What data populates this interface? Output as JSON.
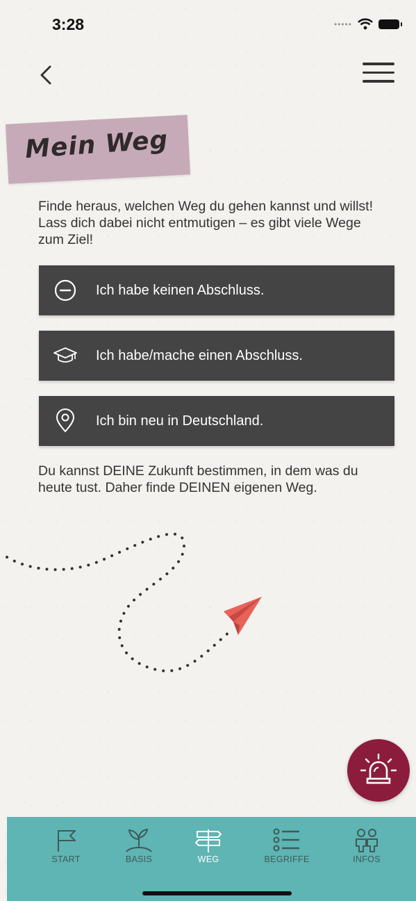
{
  "status_bar": {
    "time": "3:28"
  },
  "header": {
    "back_icon": "chevron-left-icon",
    "menu_icon": "hamburger-menu-icon",
    "title": "Mein Weg"
  },
  "intro_text": "Finde heraus, welchen Weg du gehen kannst und willst! Lass dich dabei nicht entmutigen – es gibt viele Wege zum Ziel!",
  "options": [
    {
      "label": "Ich habe keinen Abschluss.",
      "icon": "minus-circle-icon"
    },
    {
      "label": "Ich habe/mache einen Abschluss.",
      "icon": "graduation-cap-icon"
    },
    {
      "label": "Ich bin neu in Deutschland.",
      "icon": "location-pin-icon"
    }
  ],
  "outro_text": "Du kannst DEINE Zukunft bestimmen, in dem was du heute tust. Daher finde DEINEN eigenen Weg.",
  "emergency_button": {
    "icon": "siren-icon",
    "color": "#8c1c3b"
  },
  "tabbar": {
    "background": "#5eb5b3",
    "tabs": [
      {
        "label": "START",
        "icon": "flag-icon"
      },
      {
        "label": "BASIS",
        "icon": "sprout-icon"
      },
      {
        "label": "WEG",
        "icon": "signpost-icon",
        "active": true
      },
      {
        "label": "BEGRIFFE",
        "icon": "list-icon"
      },
      {
        "label": "INFOS",
        "icon": "people-icon"
      }
    ]
  },
  "colors": {
    "option_background": "#444444",
    "title_tag": "#c7aab8",
    "paper_plane": "#e8625a"
  }
}
